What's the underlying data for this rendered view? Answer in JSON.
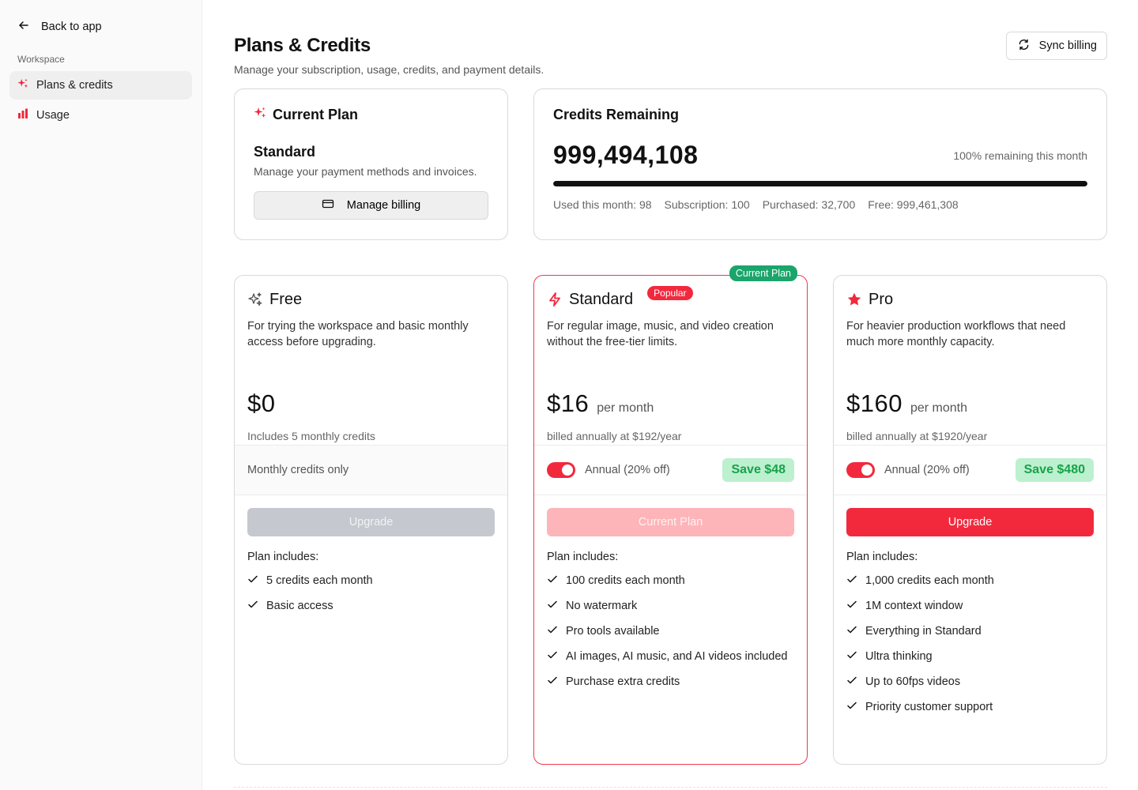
{
  "sidebar": {
    "back_label": "Back to app",
    "section_label": "Workspace",
    "items": [
      {
        "label": "Plans & credits",
        "icon": "sparkles-icon",
        "active": true
      },
      {
        "label": "Usage",
        "icon": "bar-chart-icon",
        "active": false
      }
    ]
  },
  "header": {
    "title": "Plans & Credits",
    "subtitle": "Manage your subscription, usage, credits, and payment details.",
    "sync_label": "Sync billing"
  },
  "current_plan": {
    "title": "Current Plan",
    "plan_name": "Standard",
    "description": "Manage your payment methods and invoices.",
    "manage_label": "Manage billing"
  },
  "credits": {
    "title": "Credits Remaining",
    "value": "999,494,108",
    "percent_text": "100% remaining this month",
    "progress_fraction": 1.0,
    "stats": [
      "Used this month: 98",
      "Subscription: 100",
      "Purchased: 32,700",
      "Free: 999,461,308"
    ]
  },
  "plans": [
    {
      "name": "Free",
      "icon": "sparkles-outline-icon",
      "description": "For trying the workspace and basic monthly access before upgrading.",
      "price": "$0",
      "per": "",
      "price_sub": "Includes 5 monthly credits",
      "toggle_text": "Monthly credits only",
      "button_label": "Upgrade",
      "includes_title": "Plan includes:",
      "features": [
        "5 credits each month",
        "Basic access"
      ]
    },
    {
      "name": "Standard",
      "icon": "lightning-icon",
      "badge": "Popular",
      "current_tag": "Current Plan",
      "description": "For regular image, music, and video creation without the free-tier limits.",
      "price": "$16",
      "per": "per month",
      "price_sub": "billed annually at $192/year",
      "toggle_text": "Annual (20% off)",
      "toggle_on": true,
      "save": "Save $48",
      "button_label": "Current Plan",
      "includes_title": "Plan includes:",
      "features": [
        "100 credits each month",
        "No watermark",
        "Pro tools available",
        "AI images, AI music, and AI videos included",
        "Purchase extra credits"
      ]
    },
    {
      "name": "Pro",
      "icon": "star-icon",
      "description": "For heavier production workflows that need much more monthly capacity.",
      "price": "$160",
      "per": "per month",
      "price_sub": "billed annually at $1920/year",
      "toggle_text": "Annual (20% off)",
      "toggle_on": true,
      "save": "Save $480",
      "button_label": "Upgrade",
      "includes_title": "Plan includes:",
      "features": [
        "1,000 credits each month",
        "1M context window",
        "Everything in Standard",
        "Ultra thinking",
        "Up to 60fps videos",
        "Priority customer support"
      ]
    }
  ],
  "colors": {
    "accent": "#f2293d",
    "success": "#1aa56b",
    "save_bg": "#bdf0cf",
    "save_text": "#16a34a"
  }
}
